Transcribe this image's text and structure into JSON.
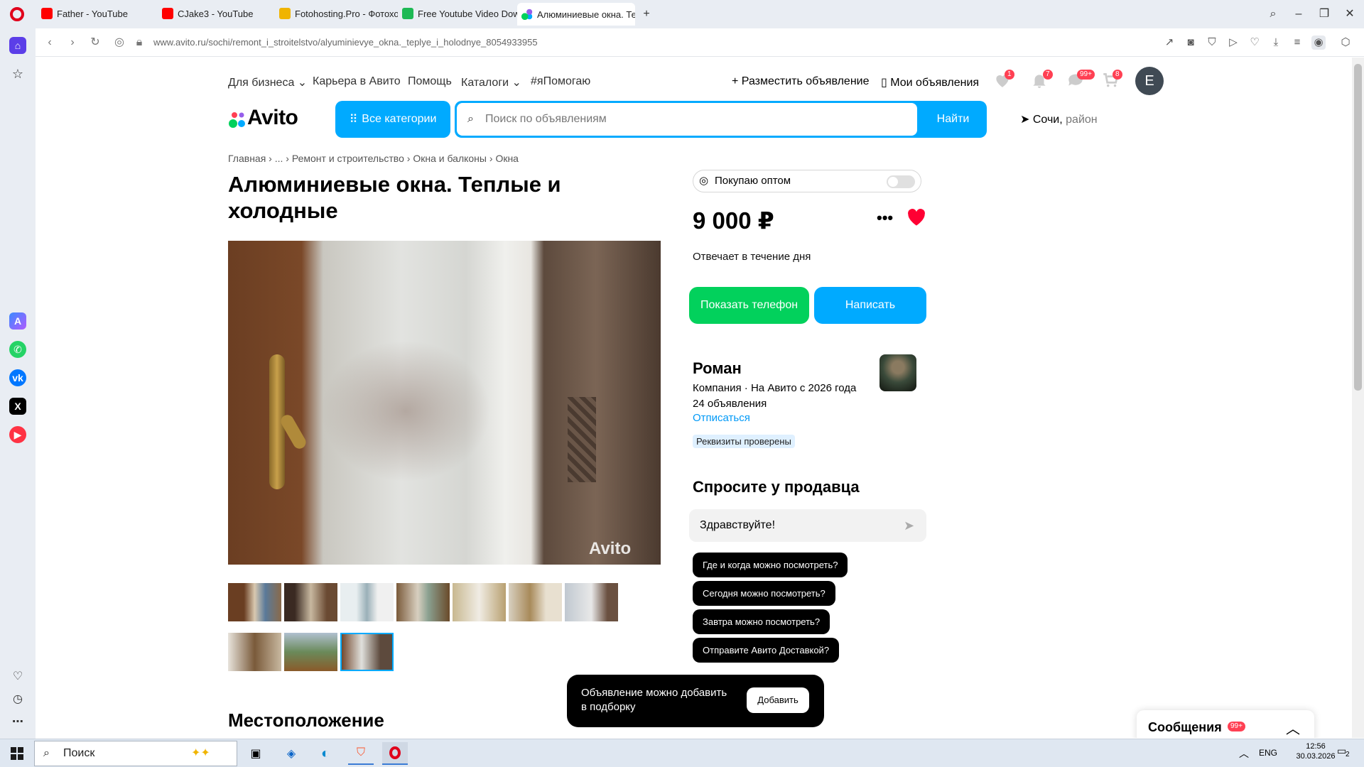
{
  "browser": {
    "tabs": [
      {
        "label": "Father - YouTube",
        "icon": "youtube-icon"
      },
      {
        "label": "CJake3 - YouTube",
        "icon": "youtube-icon"
      },
      {
        "label": "Fotohosting.Pro - Фотохо",
        "icon": "fotohosting-icon"
      },
      {
        "label": "Free Youtube Video Dowr",
        "icon": "download-icon"
      },
      {
        "label": "Алюминиевые окна. Теп",
        "icon": "avito-icon",
        "active": true
      }
    ],
    "url_host": "www.avito.ru",
    "url_path": "/sochi/remont_i_stroitelstvo/alyuminievye_okna._teplye_i_holodnye_8054933955"
  },
  "header": {
    "links": [
      "Для бизнеса",
      "Карьера в Авито",
      "Помощь",
      "Каталоги",
      "#яПомогаю"
    ],
    "post_ad": "Разместить объявление",
    "my_ads": "Мои объявления",
    "badges": {
      "favorites": "1",
      "notifications": "7",
      "messages": "99+",
      "cart": "8"
    },
    "user_initial": "E",
    "logo_text": "Avito",
    "all_categories": "Все категории",
    "search_placeholder": "Поиск по объявлениям",
    "search_button": "Найти",
    "location_city": "Сочи,",
    "location_area": "район"
  },
  "breadcrumbs": [
    "Главная",
    "...",
    "Ремонт и строительство",
    "Окна и балконы",
    "Окна"
  ],
  "listing": {
    "title": "Алюминиевые окна. Теплые и холодные",
    "watermark": "Avito",
    "section_location": "Местоположение"
  },
  "sidebar": {
    "wholesale_label": "Покупаю оптом",
    "price": "9 000 ₽",
    "response_time": "Отвечает в течение дня",
    "show_phone": "Показать телефон",
    "write": "Написать",
    "seller_name": "Роман",
    "seller_info": "Компания · На Авито с 2026 года",
    "seller_ads": "24 объявления",
    "unsubscribe": "Отписаться",
    "verified": "Реквизиты проверены",
    "ask_title": "Спросите у продавца",
    "message_value": "Здравствуйте!",
    "quick_questions": [
      "Где и когда можно посмотреть?",
      "Сегодня можно посмотреть?",
      "Завтра можно посмотреть?",
      "Отправите Авито Доставкой?"
    ]
  },
  "toast": {
    "text": "Объявление можно добавить в подборку",
    "button": "Добавить"
  },
  "messages_panel": {
    "label": "Сообщения",
    "badge": "99+"
  },
  "taskbar": {
    "search": "Поиск",
    "lang": "ENG",
    "time": "12:56",
    "date": "30.03.2026",
    "notif_count": "2"
  },
  "colors": {
    "accent": "#00aaff",
    "green": "#02d15c",
    "heart": "#ff0033",
    "badge": "#ff4053"
  }
}
